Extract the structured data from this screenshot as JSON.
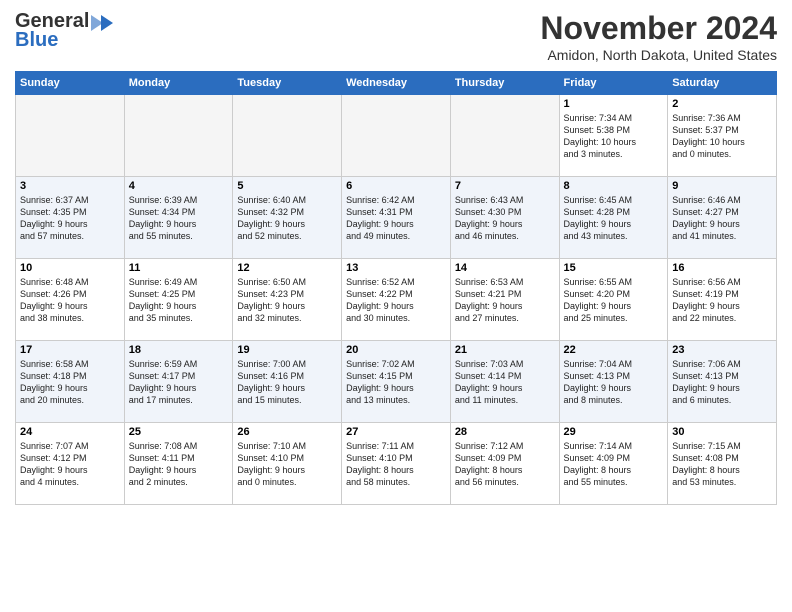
{
  "header": {
    "logo_line1": "General",
    "logo_line2": "Blue",
    "month": "November 2024",
    "location": "Amidon, North Dakota, United States"
  },
  "weekdays": [
    "Sunday",
    "Monday",
    "Tuesday",
    "Wednesday",
    "Thursday",
    "Friday",
    "Saturday"
  ],
  "weeks": [
    [
      {
        "day": "",
        "info": "",
        "empty": true
      },
      {
        "day": "",
        "info": "",
        "empty": true
      },
      {
        "day": "",
        "info": "",
        "empty": true
      },
      {
        "day": "",
        "info": "",
        "empty": true
      },
      {
        "day": "",
        "info": "",
        "empty": true
      },
      {
        "day": "1",
        "info": "Sunrise: 7:34 AM\nSunset: 5:38 PM\nDaylight: 10 hours\nand 3 minutes.",
        "empty": false
      },
      {
        "day": "2",
        "info": "Sunrise: 7:36 AM\nSunset: 5:37 PM\nDaylight: 10 hours\nand 0 minutes.",
        "empty": false
      }
    ],
    [
      {
        "day": "3",
        "info": "Sunrise: 6:37 AM\nSunset: 4:35 PM\nDaylight: 9 hours\nand 57 minutes.",
        "empty": false
      },
      {
        "day": "4",
        "info": "Sunrise: 6:39 AM\nSunset: 4:34 PM\nDaylight: 9 hours\nand 55 minutes.",
        "empty": false
      },
      {
        "day": "5",
        "info": "Sunrise: 6:40 AM\nSunset: 4:32 PM\nDaylight: 9 hours\nand 52 minutes.",
        "empty": false
      },
      {
        "day": "6",
        "info": "Sunrise: 6:42 AM\nSunset: 4:31 PM\nDaylight: 9 hours\nand 49 minutes.",
        "empty": false
      },
      {
        "day": "7",
        "info": "Sunrise: 6:43 AM\nSunset: 4:30 PM\nDaylight: 9 hours\nand 46 minutes.",
        "empty": false
      },
      {
        "day": "8",
        "info": "Sunrise: 6:45 AM\nSunset: 4:28 PM\nDaylight: 9 hours\nand 43 minutes.",
        "empty": false
      },
      {
        "day": "9",
        "info": "Sunrise: 6:46 AM\nSunset: 4:27 PM\nDaylight: 9 hours\nand 41 minutes.",
        "empty": false
      }
    ],
    [
      {
        "day": "10",
        "info": "Sunrise: 6:48 AM\nSunset: 4:26 PM\nDaylight: 9 hours\nand 38 minutes.",
        "empty": false
      },
      {
        "day": "11",
        "info": "Sunrise: 6:49 AM\nSunset: 4:25 PM\nDaylight: 9 hours\nand 35 minutes.",
        "empty": false
      },
      {
        "day": "12",
        "info": "Sunrise: 6:50 AM\nSunset: 4:23 PM\nDaylight: 9 hours\nand 32 minutes.",
        "empty": false
      },
      {
        "day": "13",
        "info": "Sunrise: 6:52 AM\nSunset: 4:22 PM\nDaylight: 9 hours\nand 30 minutes.",
        "empty": false
      },
      {
        "day": "14",
        "info": "Sunrise: 6:53 AM\nSunset: 4:21 PM\nDaylight: 9 hours\nand 27 minutes.",
        "empty": false
      },
      {
        "day": "15",
        "info": "Sunrise: 6:55 AM\nSunset: 4:20 PM\nDaylight: 9 hours\nand 25 minutes.",
        "empty": false
      },
      {
        "day": "16",
        "info": "Sunrise: 6:56 AM\nSunset: 4:19 PM\nDaylight: 9 hours\nand 22 minutes.",
        "empty": false
      }
    ],
    [
      {
        "day": "17",
        "info": "Sunrise: 6:58 AM\nSunset: 4:18 PM\nDaylight: 9 hours\nand 20 minutes.",
        "empty": false
      },
      {
        "day": "18",
        "info": "Sunrise: 6:59 AM\nSunset: 4:17 PM\nDaylight: 9 hours\nand 17 minutes.",
        "empty": false
      },
      {
        "day": "19",
        "info": "Sunrise: 7:00 AM\nSunset: 4:16 PM\nDaylight: 9 hours\nand 15 minutes.",
        "empty": false
      },
      {
        "day": "20",
        "info": "Sunrise: 7:02 AM\nSunset: 4:15 PM\nDaylight: 9 hours\nand 13 minutes.",
        "empty": false
      },
      {
        "day": "21",
        "info": "Sunrise: 7:03 AM\nSunset: 4:14 PM\nDaylight: 9 hours\nand 11 minutes.",
        "empty": false
      },
      {
        "day": "22",
        "info": "Sunrise: 7:04 AM\nSunset: 4:13 PM\nDaylight: 9 hours\nand 8 minutes.",
        "empty": false
      },
      {
        "day": "23",
        "info": "Sunrise: 7:06 AM\nSunset: 4:13 PM\nDaylight: 9 hours\nand 6 minutes.",
        "empty": false
      }
    ],
    [
      {
        "day": "24",
        "info": "Sunrise: 7:07 AM\nSunset: 4:12 PM\nDaylight: 9 hours\nand 4 minutes.",
        "empty": false
      },
      {
        "day": "25",
        "info": "Sunrise: 7:08 AM\nSunset: 4:11 PM\nDaylight: 9 hours\nand 2 minutes.",
        "empty": false
      },
      {
        "day": "26",
        "info": "Sunrise: 7:10 AM\nSunset: 4:10 PM\nDaylight: 9 hours\nand 0 minutes.",
        "empty": false
      },
      {
        "day": "27",
        "info": "Sunrise: 7:11 AM\nSunset: 4:10 PM\nDaylight: 8 hours\nand 58 minutes.",
        "empty": false
      },
      {
        "day": "28",
        "info": "Sunrise: 7:12 AM\nSunset: 4:09 PM\nDaylight: 8 hours\nand 56 minutes.",
        "empty": false
      },
      {
        "day": "29",
        "info": "Sunrise: 7:14 AM\nSunset: 4:09 PM\nDaylight: 8 hours\nand 55 minutes.",
        "empty": false
      },
      {
        "day": "30",
        "info": "Sunrise: 7:15 AM\nSunset: 4:08 PM\nDaylight: 8 hours\nand 53 minutes.",
        "empty": false
      }
    ]
  ]
}
